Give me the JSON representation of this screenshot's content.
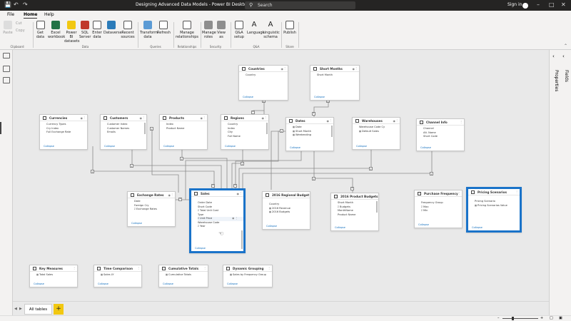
{
  "window": {
    "title": "Designing Advanced Data Models - Power BI Desktop",
    "search_placeholder": "Search",
    "signin": "Sign in"
  },
  "menu": {
    "tabs": [
      "File",
      "Home",
      "Help"
    ],
    "active": "Home"
  },
  "ribbon": {
    "paste": "Paste",
    "cut": "Cut",
    "copy": "Copy",
    "get_data": "Get data",
    "excel_workbook": "Excel workbook",
    "power_bi_datasets": "Power BI datasets",
    "sql_server": "SQL Server",
    "enter_data": "Enter data",
    "dataverse": "Dataverse",
    "recent_sources": "Recent sources",
    "transform_data": "Transform data",
    "refresh": "Refresh",
    "manage_relationships": "Manage relationships",
    "manage_roles": "Manage roles",
    "view_as": "View as",
    "qa_setup": "Q&A setup",
    "language": "Language",
    "linguistic_schema": "Linguistic schema",
    "publish": "Publish",
    "groups": {
      "clipboard": "Clipboard",
      "data": "Data",
      "queries": "Queries",
      "relationships": "Relationships",
      "security": "Security",
      "qa": "Q&A",
      "share": "Share"
    }
  },
  "right_pane": {
    "properties": "Properties",
    "fields": "Fields"
  },
  "tables": {
    "countries": {
      "name": "Countries",
      "fields": [
        "Country"
      ],
      "collapse": "Collapse"
    },
    "short_months": {
      "name": "Short Months",
      "fields": [
        "Short Month"
      ],
      "collapse": "Collapse"
    },
    "currencies": {
      "name": "Currencies",
      "fields": [
        "Currency Types",
        "Cry Index",
        "Full Exchange Rate"
      ],
      "collapse": "Collapse"
    },
    "customers": {
      "name": "Customers",
      "fields": [
        "Customer Index",
        "Customer Names",
        "Emails"
      ],
      "collapse": "Collapse"
    },
    "products": {
      "name": "Products",
      "fields": [
        "Index",
        "Product Name"
      ],
      "collapse": "Collapse"
    },
    "regions": {
      "name": "Regions",
      "fields": [
        "Country",
        "Index",
        "City",
        "Full Name"
      ],
      "collapse": "Collapse"
    },
    "dates": {
      "name": "Dates",
      "fields": [
        "Date",
        "Short Month",
        "Weekending"
      ],
      "collapse": "Collapse"
    },
    "warehouses": {
      "name": "Warehouses",
      "fields": [
        "Warehouse Code Cy",
        "Default Sales"
      ],
      "collapse": "Collapse"
    },
    "channel_info": {
      "name": "Channel Info",
      "fields": [
        "Channel",
        "Alt. Name",
        "Short Code"
      ],
      "collapse": "Collapse"
    },
    "exchange_rates": {
      "name": "Exchange Rates",
      "fields": [
        "Date",
        "Foreign Cry",
        "Exchange Rates"
      ],
      "collapse": "Collapse"
    },
    "sales": {
      "name": "Sales",
      "fields": [
        "Order Date",
        "Short Code",
        "Total Unit Cost",
        "Type",
        "Unit Price",
        "Warehouse Code",
        "Year"
      ],
      "collapse": "Collapse"
    },
    "regional_budget": {
      "name": "2016 Regional Budget",
      "fields": [
        "Country",
        "2016 Revenue",
        "2016 Budgets"
      ],
      "collapse": "Collapse"
    },
    "product_budgets": {
      "name": "2016 Product Budgets",
      "fields": [
        "Short Month",
        "Budgets",
        "MonthName",
        "Product Name"
      ],
      "collapse": "Collapse"
    },
    "purchase_frequency": {
      "name": "Purchase Frequency",
      "fields": [
        "Frequency Group",
        "Max",
        "Min"
      ],
      "collapse": "Collapse"
    },
    "pricing_scenarios": {
      "name": "Pricing Scenarios",
      "fields": [
        "Pricing Scenario",
        "Pricing Scenarios Value"
      ],
      "collapse": "Collapse"
    },
    "key_measures": {
      "name": "Key Measures",
      "fields": [
        "Total Sales"
      ],
      "collapse": "Collapse"
    },
    "time_comparison": {
      "name": "Time Comparison",
      "fields": [
        "Sales LY"
      ],
      "collapse": "Collapse"
    },
    "cumulative_totals": {
      "name": "Cumulative Totals",
      "fields": [
        "Cumulative Totals"
      ],
      "collapse": "Collapse"
    },
    "dynamic_grouping": {
      "name": "Dynamic Grouping",
      "fields": [
        "Sales by Frequency Group"
      ],
      "collapse": "Collapse"
    }
  },
  "relationship_markers": {
    "one": "1",
    "many": "*"
  },
  "bottom": {
    "tab": "All tables",
    "add": "+"
  },
  "colors": {
    "accent": "#f2c811",
    "selection": "#1a73c9",
    "link": "#106ebe"
  }
}
